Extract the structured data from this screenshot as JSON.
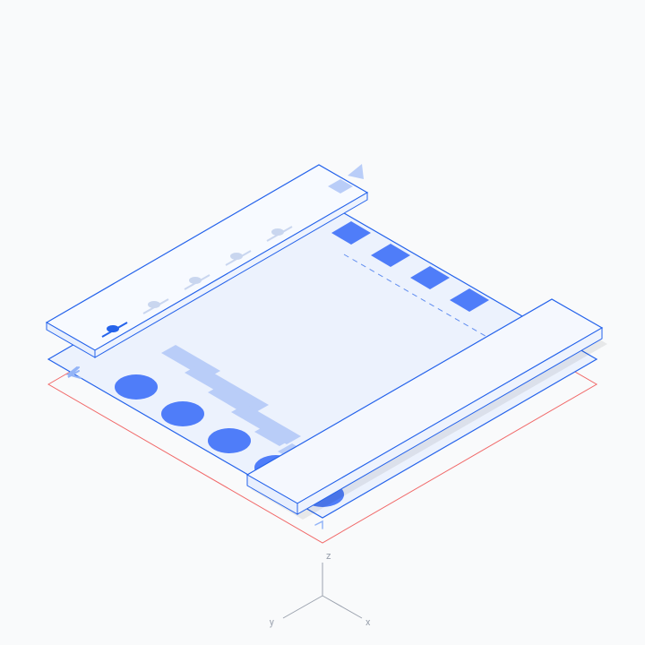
{
  "colors": {
    "blue_stroke": "#2563eb",
    "blue_light": "#93b4f7",
    "blue_fill": "#4f7df9",
    "blue_pale": "#e8effd",
    "blue_verypale": "#f2f6fe",
    "red_stroke": "#ef4444",
    "gray_stroke": "#d1d5db",
    "gray_mid": "#9ca3af"
  },
  "axes": {
    "x": "x",
    "y": "y",
    "z": "z"
  },
  "layers": {
    "note": "isometric diagram of stacked UI surfaces"
  }
}
